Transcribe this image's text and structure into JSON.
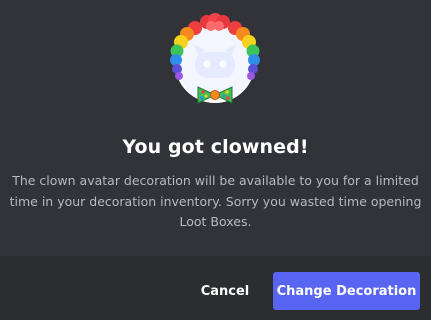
{
  "dialog": {
    "title": "You got clowned!",
    "description": "The clown avatar decoration will be available to you for a limited time in your decoration inventory. Sorry you wasted time opening Loot Boxes.",
    "cancel_label": "Cancel",
    "confirm_label": "Change Decoration"
  },
  "colors": {
    "background": "#313338",
    "footer": "#2b2d31",
    "primary_button": "#5865f2",
    "title_text": "#ffffff",
    "body_text": "#b5bac1"
  },
  "icons": {
    "avatar": "clown-avatar-decoration-icon"
  }
}
